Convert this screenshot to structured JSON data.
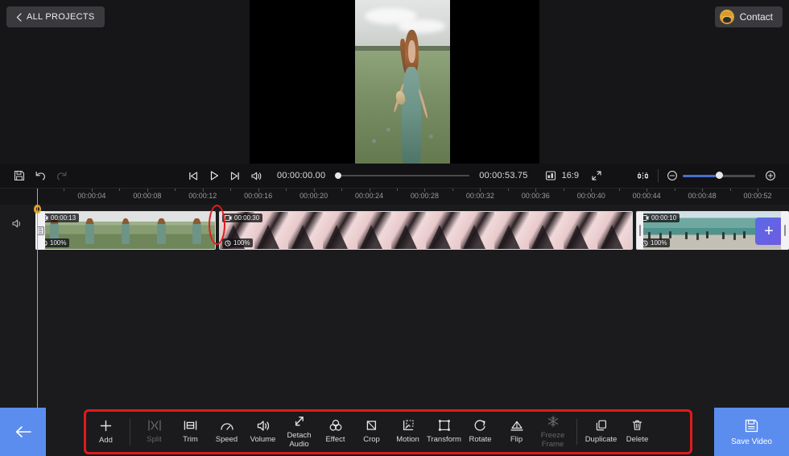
{
  "header": {
    "all_projects_label": "ALL PROJECTS",
    "contact_label": "Contact"
  },
  "preview": {
    "description": "Woman in teal dress standing in a flower field, portrait video letterboxed on black background"
  },
  "controls": {
    "save_icon": "floppy-disk-icon",
    "undo_icon": "undo-icon",
    "redo_icon": "redo-icon",
    "prev_icon": "skip-previous-icon",
    "play_icon": "play-icon",
    "next_icon": "skip-next-icon",
    "volume_icon": "volume-icon",
    "current_time": "00:00:00.00",
    "total_time": "00:00:53.75",
    "aspect_icon": "aspect-ratio-icon",
    "aspect_ratio": "16:9",
    "fullscreen_icon": "fullscreen-icon",
    "adjust_icon": "adjust-icon",
    "zoom_out_icon": "zoom-out-icon",
    "zoom_in_icon": "zoom-in-icon",
    "zoom_value": 45
  },
  "timeline": {
    "mute_icon": "speaker-icon",
    "ruler_ticks": [
      "00:00:04",
      "00:00:08",
      "00:00:12",
      "00:00:16",
      "00:00:20",
      "00:00:24",
      "00:00:28",
      "00:00:32",
      "00:00:36",
      "00:00:40",
      "00:00:44",
      "00:00:48",
      "00:00:52"
    ],
    "clips": [
      {
        "duration": "00:00:13",
        "speed": "100%",
        "type_icon": "video-clip-icon",
        "speed_icon": "speed-icon"
      },
      {
        "duration": "00:00:30",
        "speed": "100%",
        "type_icon": "video-clip-icon",
        "speed_icon": "speed-icon"
      },
      {
        "duration": "00:00:10",
        "speed": "100%",
        "type_icon": "video-clip-icon",
        "speed_icon": "speed-icon"
      }
    ],
    "add_clip_label": "+"
  },
  "toolbar": {
    "back_icon": "arrow-left-icon",
    "tools": [
      {
        "label": "Add",
        "icon": "plus-icon",
        "disabled": false
      },
      {
        "label": "Split",
        "icon": "split-icon",
        "disabled": true
      },
      {
        "label": "Trim",
        "icon": "trim-icon",
        "disabled": false
      },
      {
        "label": "Speed",
        "icon": "speed-gauge-icon",
        "disabled": false
      },
      {
        "label": "Volume",
        "icon": "volume-icon",
        "disabled": false
      },
      {
        "label": "Detach\nAudio",
        "icon": "detach-audio-icon",
        "disabled": false
      },
      {
        "label": "Effect",
        "icon": "effect-icon",
        "disabled": false
      },
      {
        "label": "Crop",
        "icon": "crop-icon",
        "disabled": false
      },
      {
        "label": "Motion",
        "icon": "motion-icon",
        "disabled": false
      },
      {
        "label": "Transform",
        "icon": "transform-icon",
        "disabled": false
      },
      {
        "label": "Rotate",
        "icon": "rotate-icon",
        "disabled": false
      },
      {
        "label": "Flip",
        "icon": "flip-icon",
        "disabled": false
      },
      {
        "label": "Freeze\nFrame",
        "icon": "freeze-frame-icon",
        "disabled": true
      },
      {
        "label": "Duplicate",
        "icon": "duplicate-icon",
        "disabled": false
      },
      {
        "label": "Delete",
        "icon": "trash-icon",
        "disabled": false
      }
    ],
    "save_label": "Save Video",
    "save_icon": "floppy-disk-icon"
  },
  "annotations": {
    "accent_color": "#e01b1b",
    "highlight_clip_boundary": "red ellipse around clip trim handle at 00:00:13",
    "highlight_toolbar": "red rounded rectangle around the editing toolbar"
  },
  "colors": {
    "background": "#1b1b1d",
    "panel": "#121214",
    "accent_blue": "#5b8def",
    "playhead": "#e0a32a",
    "annotation_red": "#e01b1b"
  }
}
